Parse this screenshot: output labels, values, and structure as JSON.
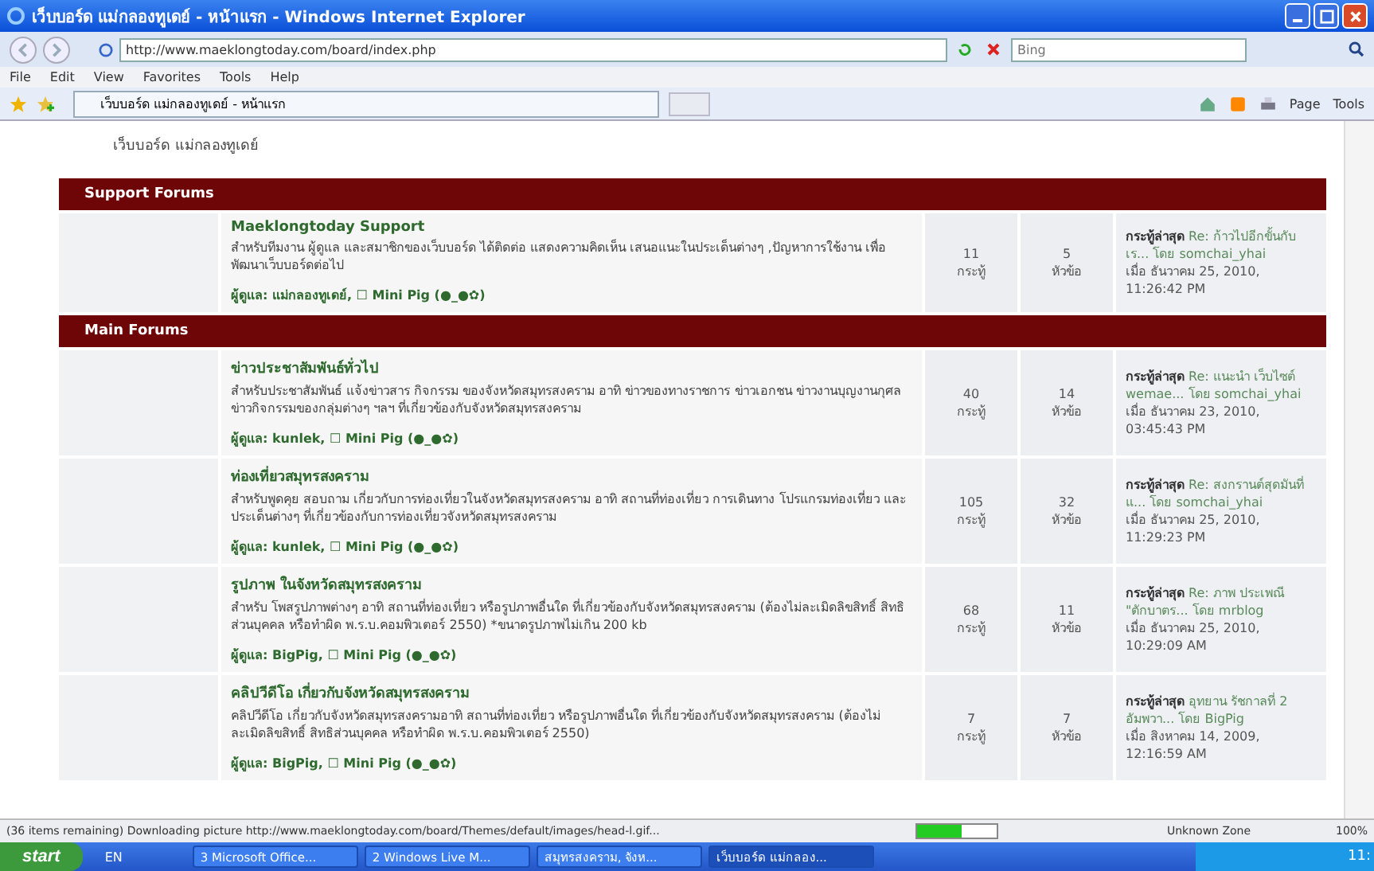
{
  "window": {
    "title": "เว็บบอร์ด แม่กลองทูเดย์ - หน้าแรก - Windows Internet Explorer"
  },
  "address_bar": {
    "value": "http://www.maeklongtoday.com/board/index.php"
  },
  "search": {
    "placeholder": "Bing"
  },
  "menu": [
    "File",
    "Edit",
    "View",
    "Favorites",
    "Tools",
    "Help"
  ],
  "tab": {
    "label": "เว็บบอร์ด แม่กลองทูเดย์ - หน้าแรก"
  },
  "command_bar": {
    "page": "Page",
    "tools": "Tools"
  },
  "breadcrumb": "เว็บบอร์ด แม่กลองทูเดย์",
  "categories": [
    {
      "title": "Support Forums",
      "boards": [
        {
          "name": "Maeklongtoday Support",
          "description": "สำหรับทีมงาน ผู้ดูแล และสมาชิกของเว็บบอร์ด ได้ติดต่อ แสดงความคิดเห็น เสนอแนะในประเด็นต่างๆ ,ปัญหาการใช้งาน เพื่อพัฒนาเว็บบอร์ดต่อไป",
          "moderators": "ผู้ดูแล: แม่กลองทูเดย์, ☐ Mini Pig (●_●✿)",
          "posts": "11",
          "posts_label": "กระทู้",
          "topics": "5",
          "topics_label": "หัวข้อ",
          "last_label": "กระทู้ล่าสุด",
          "last_subject": "Re: ก้าวไปอีกขั้นกับ เร...",
          "last_by": "โดย somchai_yhai",
          "last_date": "เมื่อ ธันวาคม 25, 2010, 11:26:42 PM"
        }
      ]
    },
    {
      "title": "Main Forums",
      "boards": [
        {
          "name": "ข่าวประชาสัมพันธ์ทั่วไป",
          "description": "สำหรับประชาสัมพันธ์ แจ้งข่าวสาร กิจกรรม ของจังหวัดสมุทรสงคราม อาทิ ข่าวของทางราชการ ข่าวเอกชน ข่าวงานบุญงานกุศล ข่าวกิจกรรมของกลุ่มต่างๆ ฯลฯ ที่เกี่ยวข้องกับจังหวัดสมุทรสงคราม",
          "moderators": "ผู้ดูแล: kunlek, ☐ Mini Pig (●_●✿)",
          "posts": "40",
          "posts_label": "กระทู้",
          "topics": "14",
          "topics_label": "หัวข้อ",
          "last_label": "กระทู้ล่าสุด",
          "last_subject": "Re: แนะนำ เว็บไซต์ wemae...",
          "last_by": "โดย somchai_yhai",
          "last_date": "เมื่อ ธันวาคม 23, 2010, 03:45:43 PM"
        },
        {
          "name": "ท่องเที่ยวสมุทรสงคราม",
          "description": "สำหรับพูดคุย สอบถาม เกี่ยวกับการท่องเที่ยวในจังหวัดสมุทรสงคราม อาทิ สถานที่ท่องเที่ยว การเดินทาง โปรแกรมท่องเที่ยว และประเด็นต่างๆ ที่เกี่ยวข้องกับการท่องเที่ยวจังหวัดสมุทรสงคราม",
          "moderators": "ผู้ดูแล: kunlek, ☐ Mini Pig (●_●✿)",
          "posts": "105",
          "posts_label": "กระทู้",
          "topics": "32",
          "topics_label": "หัวข้อ",
          "last_label": "กระทู้ล่าสุด",
          "last_subject": "Re: สงกรานต์สุดมันที่ แ...",
          "last_by": "โดย somchai_yhai",
          "last_date": "เมื่อ ธันวาคม 25, 2010, 11:29:23 PM"
        },
        {
          "name": "รูปภาพ ในจังหวัดสมุทรสงคราม",
          "description": "สำหรับ โพสรูปภาพต่างๆ อาทิ สถานที่ท่องเที่ยว หรือรูปภาพอื่นใด ที่เกี่ยวข้องกับจังหวัดสมุทรสงคราม (ต้องไม่ละเมิดลิขสิทธิ์ สิทธิส่วนบุคคล หรือทำผิด พ.ร.บ.คอมพิวเตอร์ 2550) *ขนาดรูปภาพไม่เกิน 200 kb",
          "moderators": "ผู้ดูแล: BigPig, ☐ Mini Pig (●_●✿)",
          "posts": "68",
          "posts_label": "กระทู้",
          "topics": "11",
          "topics_label": "หัวข้อ",
          "last_label": "กระทู้ล่าสุด",
          "last_subject": "Re: ภาพ ประเพณี \"ตักบาตร...",
          "last_by": "โดย mrblog",
          "last_date": "เมื่อ ธันวาคม 25, 2010, 10:29:09 AM"
        },
        {
          "name": "คลิปวีดีโอ เกี่ยวกับจังหวัดสมุทรสงคราม",
          "description": "คลิปวีดีโอ เกี่ยวกับจังหวัดสมุทรสงครามอาทิ สถานที่ท่องเที่ยว หรือรูปภาพอื่นใด ที่เกี่ยวข้องกับจังหวัดสมุทรสงคราม (ต้องไม่ละเมิดลิขสิทธิ์ สิทธิส่วนบุคคล หรือทำผิด พ.ร.บ.คอมพิวเตอร์ 2550)",
          "moderators": "ผู้ดูแล: BigPig, ☐ Mini Pig (●_●✿)",
          "posts": "7",
          "posts_label": "กระทู้",
          "topics": "7",
          "topics_label": "หัวข้อ",
          "last_label": "กระทู้ล่าสุด",
          "last_subject": "อุทยาน รัชกาลที่ 2 อัมพวา...",
          "last_by": "โดย BigPig",
          "last_date": "เมื่อ สิงหาคม 14, 2009, 12:16:59 AM"
        }
      ]
    }
  ],
  "status_bar": {
    "text": "(36 items remaining) Downloading picture http://www.maeklongtoday.com/board/Themes/default/images/head-l.gif...",
    "progress": {
      "level": 0.55
    },
    "zone": "Unknown Zone",
    "zoom": "100%"
  },
  "taskbar": {
    "start": "start",
    "language": "EN",
    "tasks": [
      "3 Microsoft Office...",
      "2 Windows Live M...",
      "สมุทรสงคราม, จังห...",
      "เว็บบอร์ด แม่กลอง..."
    ],
    "clock": "11:"
  }
}
